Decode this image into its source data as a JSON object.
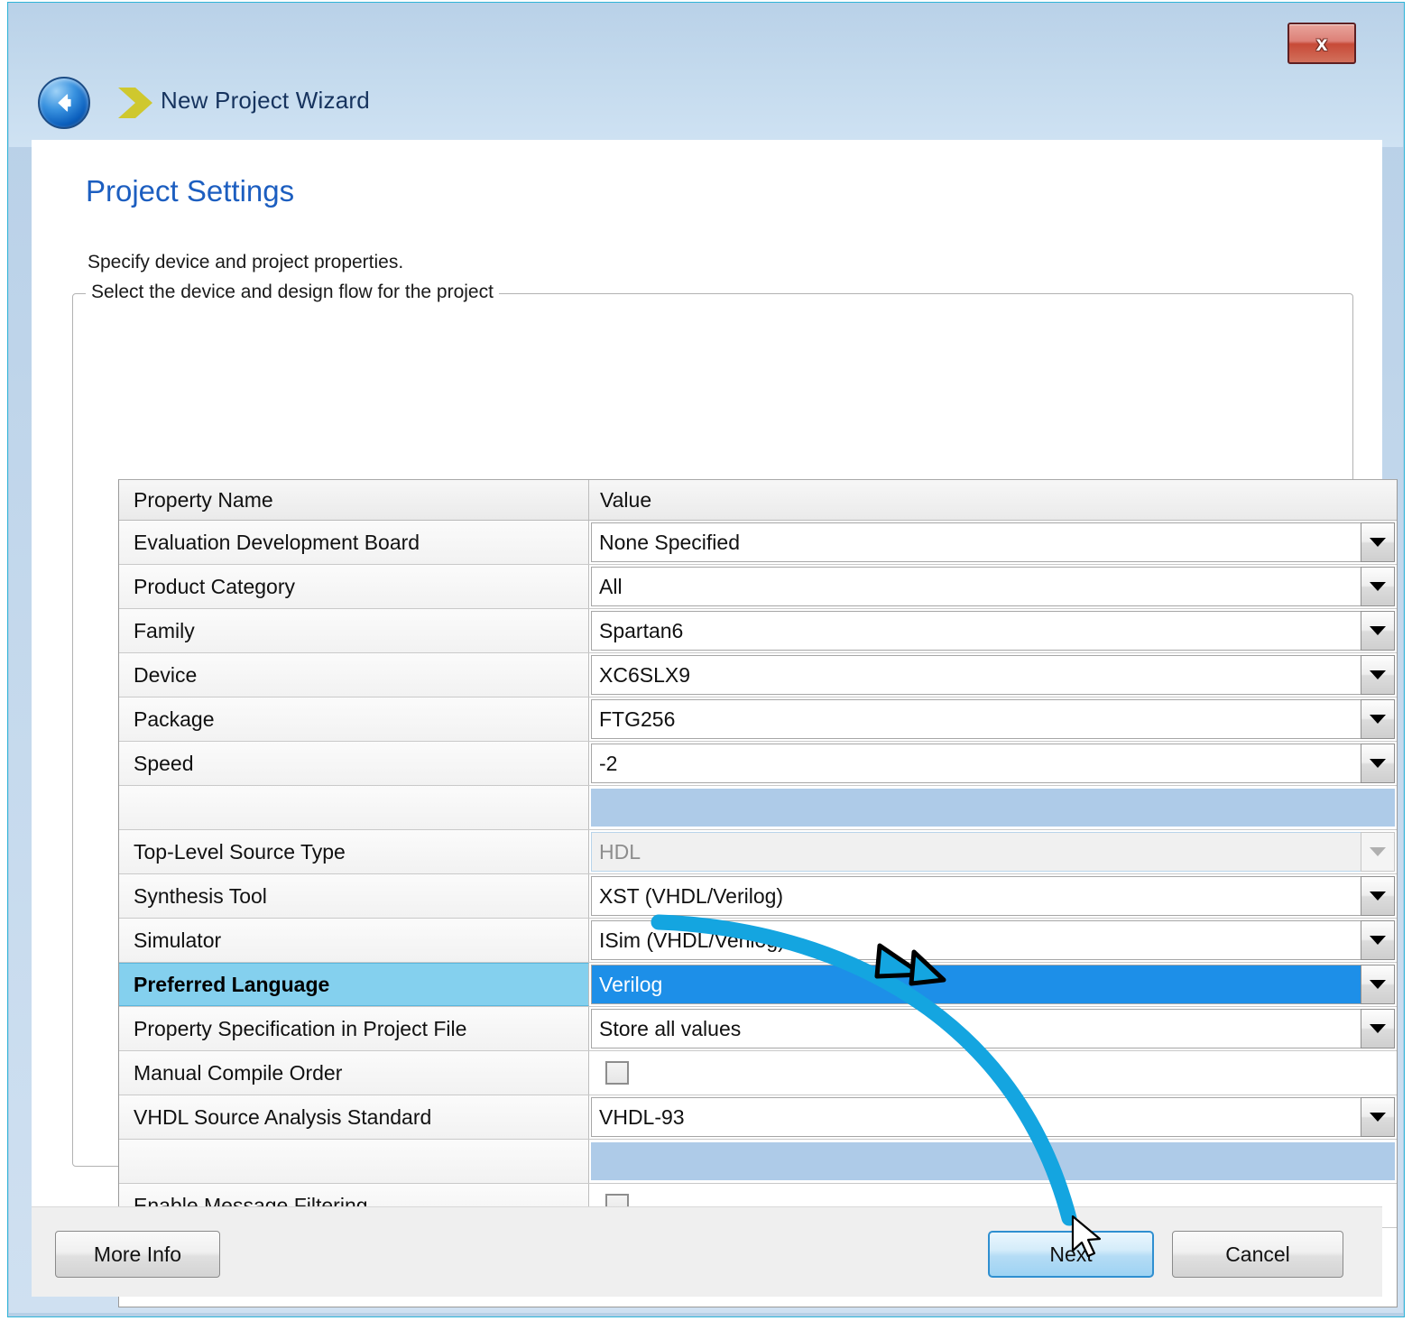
{
  "window": {
    "wizard_title": "New Project Wizard",
    "close_label": "x",
    "back_icon": "back-arrow-icon",
    "chevron_icon": "chevron-right-icon"
  },
  "page": {
    "title": "Project Settings",
    "subtitle": "Specify device and project properties.",
    "group_legend": "Select the device and design flow for the project"
  },
  "grid": {
    "columns": [
      "Property Name",
      "Value"
    ],
    "rows": [
      {
        "name": "Evaluation Development Board",
        "value": "None Specified",
        "kind": "combo"
      },
      {
        "name": "Product Category",
        "value": "All",
        "kind": "combo"
      },
      {
        "name": "Family",
        "value": "Spartan6",
        "kind": "combo"
      },
      {
        "name": "Device",
        "value": "XC6SLX9",
        "kind": "combo"
      },
      {
        "name": "Package",
        "value": "FTG256",
        "kind": "combo"
      },
      {
        "name": "Speed",
        "value": "-2",
        "kind": "combo"
      },
      {
        "name": "",
        "value": "",
        "kind": "spacer"
      },
      {
        "name": "Top-Level Source Type",
        "value": "HDL",
        "kind": "combo-disabled"
      },
      {
        "name": "Synthesis Tool",
        "value": "XST (VHDL/Verilog)",
        "kind": "combo"
      },
      {
        "name": "Simulator",
        "value": "ISim (VHDL/Verilog)",
        "kind": "combo"
      },
      {
        "name": "Preferred Language",
        "value": "Verilog",
        "kind": "combo-selected"
      },
      {
        "name": "Property Specification in Project File",
        "value": "Store all values",
        "kind": "combo"
      },
      {
        "name": "Manual Compile Order",
        "value": "",
        "kind": "checkbox",
        "checked": false
      },
      {
        "name": "VHDL Source Analysis Standard",
        "value": "VHDL-93",
        "kind": "combo"
      },
      {
        "name": "",
        "value": "",
        "kind": "spacer"
      },
      {
        "name": "Enable Message Filtering",
        "value": "",
        "kind": "checkbox",
        "checked": false
      },
      {
        "name": "",
        "value": "",
        "kind": "blank"
      },
      {
        "name": "",
        "value": "",
        "kind": "blank"
      }
    ]
  },
  "buttons": {
    "more_info": "More Info",
    "next": "Next",
    "cancel": "Cancel"
  },
  "annotation": {
    "color": "#14a5e0",
    "outline": "#000000",
    "description": "curved arrow pointing to Next button"
  },
  "colors": {
    "accent_blue": "#1d8fe8",
    "highlight_row": "#84d0ee",
    "spacer_fill": "#aecbe8",
    "title_blue": "#1c5ec0",
    "window_frame": "#b6cfe6",
    "frame_edge": "#2fb4d8"
  }
}
